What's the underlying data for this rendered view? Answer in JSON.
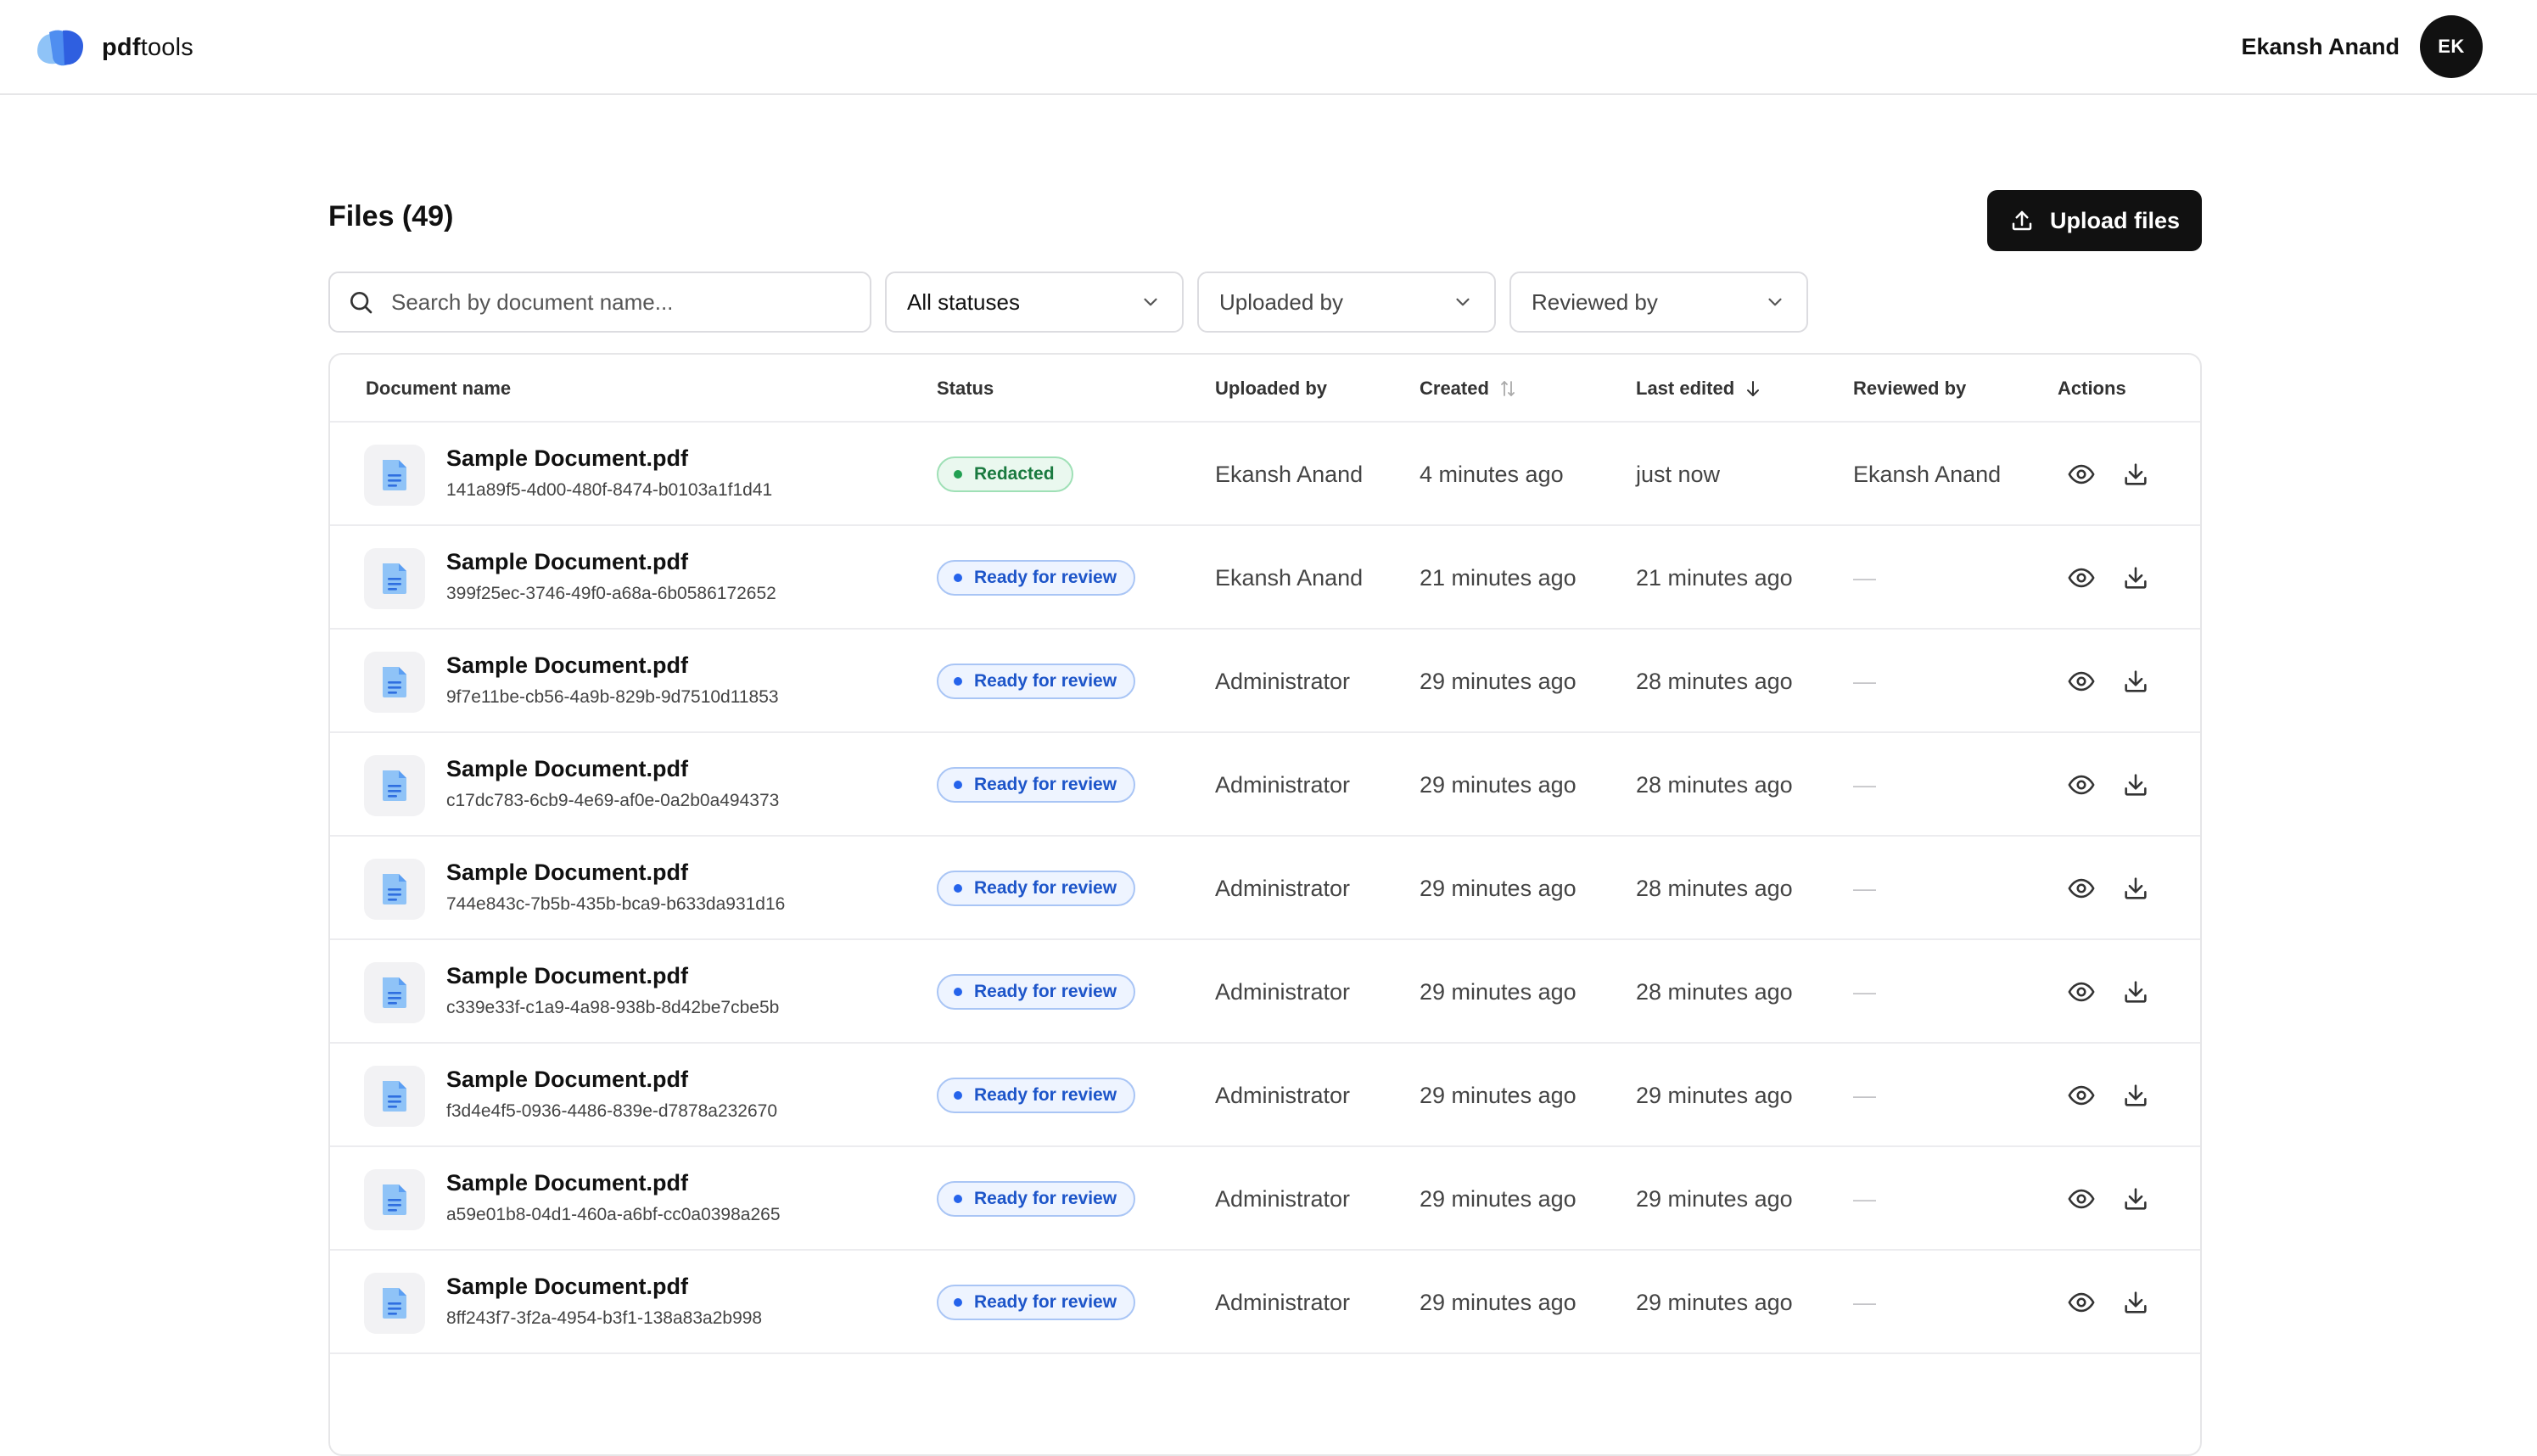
{
  "brand": {
    "name_bold": "pdf",
    "name_rest": "tools"
  },
  "user": {
    "name": "Ekansh Anand",
    "initials": "EK"
  },
  "page": {
    "title": "Files (49)",
    "upload_label": "Upload files"
  },
  "filters": {
    "search_placeholder": "Search by document name...",
    "status": "All statuses",
    "uploaded_by": "Uploaded by",
    "reviewed_by": "Reviewed by"
  },
  "columns": {
    "document": "Document name",
    "status": "Status",
    "uploaded_by": "Uploaded by",
    "created": "Created",
    "last_edited": "Last edited",
    "reviewed_by": "Reviewed by",
    "actions": "Actions"
  },
  "colors": {
    "accent": "#111111",
    "redacted": "#22a052",
    "review": "#2563eb"
  },
  "rows": [
    {
      "name": "Sample Document.pdf",
      "id": "141a89f5-4d00-480f-8474-b0103a1f1d41",
      "status": "Redacted",
      "status_kind": "green",
      "uploaded_by": "Ekansh Anand",
      "created": "4 minutes ago",
      "last_edited": "just now",
      "reviewed_by": "Ekansh Anand"
    },
    {
      "name": "Sample Document.pdf",
      "id": "399f25ec-3746-49f0-a68a-6b0586172652",
      "status": "Ready for review",
      "status_kind": "blue",
      "uploaded_by": "Ekansh Anand",
      "created": "21 minutes ago",
      "last_edited": "21 minutes ago",
      "reviewed_by": "—"
    },
    {
      "name": "Sample Document.pdf",
      "id": "9f7e11be-cb56-4a9b-829b-9d7510d11853",
      "status": "Ready for review",
      "status_kind": "blue",
      "uploaded_by": "Administrator",
      "created": "29 minutes ago",
      "last_edited": "28 minutes ago",
      "reviewed_by": "—"
    },
    {
      "name": "Sample Document.pdf",
      "id": "c17dc783-6cb9-4e69-af0e-0a2b0a494373",
      "status": "Ready for review",
      "status_kind": "blue",
      "uploaded_by": "Administrator",
      "created": "29 minutes ago",
      "last_edited": "28 minutes ago",
      "reviewed_by": "—"
    },
    {
      "name": "Sample Document.pdf",
      "id": "744e843c-7b5b-435b-bca9-b633da931d16",
      "status": "Ready for review",
      "status_kind": "blue",
      "uploaded_by": "Administrator",
      "created": "29 minutes ago",
      "last_edited": "28 minutes ago",
      "reviewed_by": "—"
    },
    {
      "name": "Sample Document.pdf",
      "id": "c339e33f-c1a9-4a98-938b-8d42be7cbe5b",
      "status": "Ready for review",
      "status_kind": "blue",
      "uploaded_by": "Administrator",
      "created": "29 minutes ago",
      "last_edited": "28 minutes ago",
      "reviewed_by": "—"
    },
    {
      "name": "Sample Document.pdf",
      "id": "f3d4e4f5-0936-4486-839e-d7878a232670",
      "status": "Ready for review",
      "status_kind": "blue",
      "uploaded_by": "Administrator",
      "created": "29 minutes ago",
      "last_edited": "29 minutes ago",
      "reviewed_by": "—"
    },
    {
      "name": "Sample Document.pdf",
      "id": "a59e01b8-04d1-460a-a6bf-cc0a0398a265",
      "status": "Ready for review",
      "status_kind": "blue",
      "uploaded_by": "Administrator",
      "created": "29 minutes ago",
      "last_edited": "29 minutes ago",
      "reviewed_by": "—"
    },
    {
      "name": "Sample Document.pdf",
      "id": "8ff243f7-3f2a-4954-b3f1-138a83a2b998",
      "status": "Ready for review",
      "status_kind": "blue",
      "uploaded_by": "Administrator",
      "created": "29 minutes ago",
      "last_edited": "29 minutes ago",
      "reviewed_by": "—"
    }
  ]
}
